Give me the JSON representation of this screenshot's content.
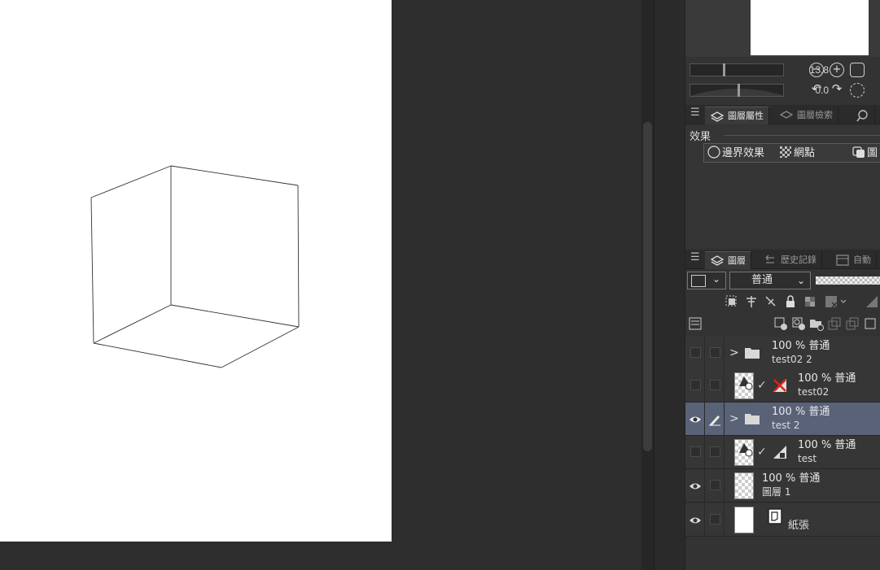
{
  "navigator": {
    "zoom_value": "13.8",
    "rotation_value": "0.0"
  },
  "property_tabs": [
    {
      "label": "圖層屬性",
      "active": true
    },
    {
      "label": "圖層檢索",
      "active": false
    }
  ],
  "effect": {
    "legend": "效果",
    "items": [
      {
        "label": "邊界效果"
      },
      {
        "label": "網點"
      },
      {
        "label": "圖"
      }
    ]
  },
  "layer_tabs": [
    {
      "label": "圖層",
      "active": true
    },
    {
      "label": "歷史記錄",
      "active": false
    },
    {
      "label": "自動",
      "active": false
    }
  ],
  "layer_tools": {
    "blend_mode": "普通"
  },
  "layers": [
    {
      "opacity_blend": "100 % 普通",
      "name": "test02 2",
      "kind": "folder",
      "visible": false,
      "selected": false
    },
    {
      "opacity_blend": "100 % 普通",
      "name": "test02",
      "kind": "3d",
      "visible": false,
      "selected": false
    },
    {
      "opacity_blend": "100 % 普通",
      "name": "test 2",
      "kind": "folder",
      "visible": true,
      "selected": true
    },
    {
      "opacity_blend": "100 % 普通",
      "name": "test",
      "kind": "3d",
      "visible": false,
      "selected": false
    },
    {
      "opacity_blend": "100 % 普通",
      "name": "圖層 1",
      "kind": "raster",
      "visible": true,
      "selected": false
    },
    {
      "opacity_blend": "",
      "name": "紙張",
      "kind": "paper",
      "visible": true,
      "selected": false
    }
  ],
  "colors": {
    "selected_row": "#5a6278",
    "panel_bg": "#333333",
    "canvas_bg": "#2d2d2d"
  }
}
